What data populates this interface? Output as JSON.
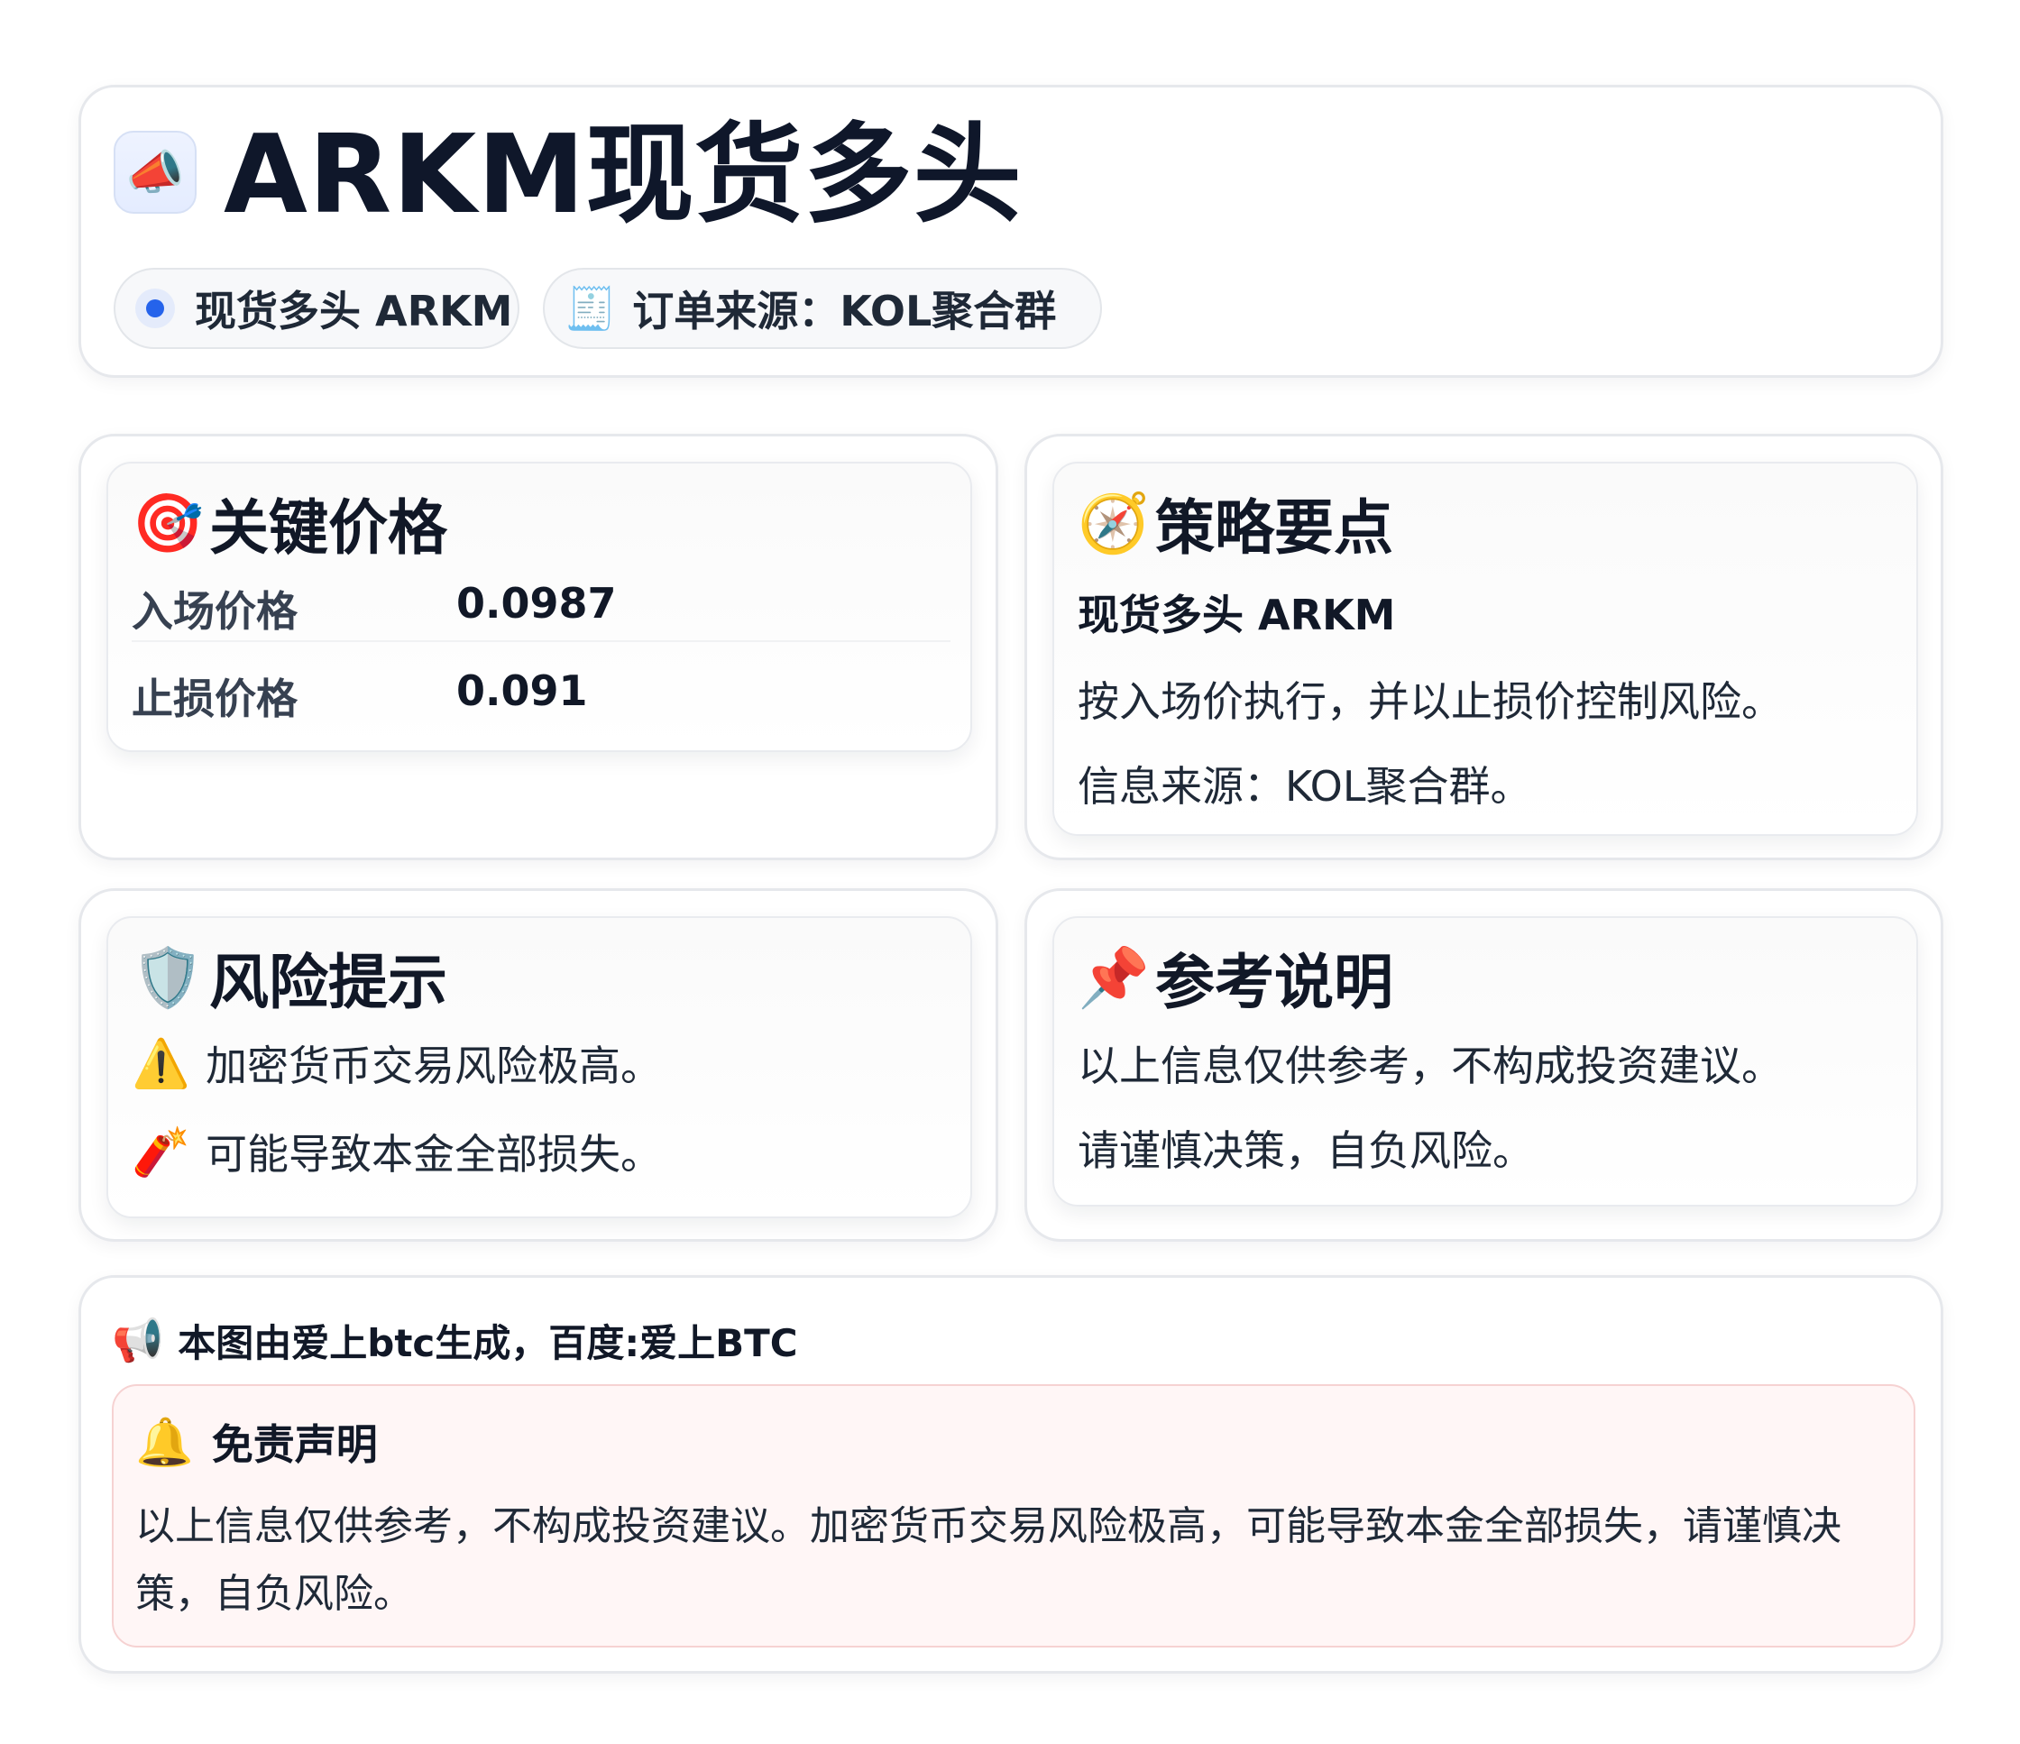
{
  "header": {
    "logo_icon": "megaphone-icon",
    "logo_glyph": "📣",
    "title": "ARKM现货多头",
    "tags": [
      {
        "icon": "blue-dot-icon",
        "label": "现货多头 ARKM"
      },
      {
        "icon": "receipt-icon",
        "glyph": "🧾",
        "label": "订单来源：KOL聚合群"
      }
    ]
  },
  "key_prices": {
    "icon": "target-icon",
    "glyph": "🎯",
    "title": "关键价格",
    "rows": [
      {
        "label": "入场价格",
        "value": "0.0987"
      },
      {
        "label": "止损价格",
        "value": "0.091"
      }
    ]
  },
  "strategy": {
    "icon": "compass-icon",
    "glyph": "🧭",
    "title": "策略要点",
    "subtitle": "现货多头 ARKM",
    "lines": [
      "按入场价执行，并以止损价控制风险。",
      "信息来源：KOL聚合群。"
    ]
  },
  "risk": {
    "icon": "shield-icon",
    "glyph": "🛡️",
    "title": "风险提示",
    "items": [
      {
        "icon": "warning-icon",
        "glyph": "⚠️",
        "text": "加密货币交易风险极高。"
      },
      {
        "icon": "firecracker-icon",
        "glyph": "🧨",
        "text": "可能导致本金全部损失。"
      }
    ]
  },
  "reference": {
    "icon": "pushpin-icon",
    "glyph": "📌",
    "title": "参考说明",
    "lines": [
      "以上信息仅供参考，不构成投资建议。",
      "请谨慎决策，自负风险。"
    ]
  },
  "footer": {
    "icon": "loudspeaker-icon",
    "glyph": "📢",
    "credit": "本图由爱上btc生成，百度:爱上BTC",
    "disclaimer": {
      "icon": "bell-icon",
      "glyph": "🔔",
      "title": "免责声明",
      "text": "以上信息仅供参考，不构成投资建议。加密货币交易风险极高，可能导致本金全部损失，请谨慎决策，自负风险。"
    }
  },
  "colors": {
    "accent_blue": "#2563eb",
    "disclaimer_bg": "#fff6f6",
    "disclaimer_border": "#f6d2d2",
    "text_dark": "#111827"
  }
}
